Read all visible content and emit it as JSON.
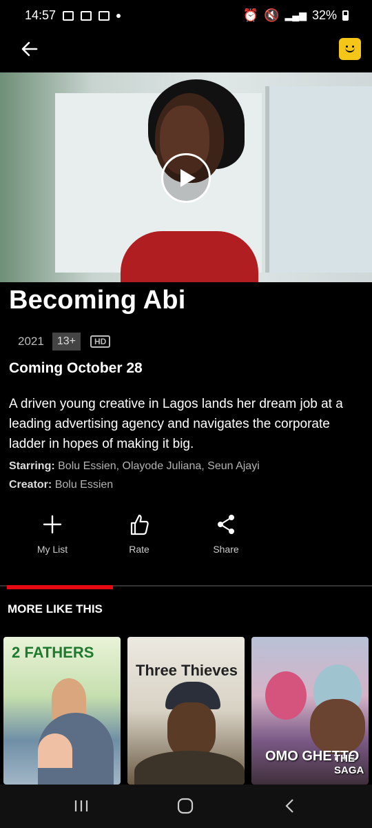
{
  "status_bar": {
    "time": "14:57",
    "battery": "32%"
  },
  "show": {
    "title": "Becoming Abi",
    "year": "2021",
    "rating": "13+",
    "quality": "HD",
    "availability": "Coming October 28",
    "description": "A driven young creative in Lagos lands her dream job at a leading advertising agency and navigates the corporate ladder in hopes of making it big.",
    "starring_label": "Starring:",
    "starring": "Bolu Essien, Olayode Juliana, Seun Ajayi",
    "creator_label": "Creator:",
    "creator": "Bolu Essien"
  },
  "actions": [
    {
      "label": "My List",
      "icon": "plus-icon"
    },
    {
      "label": "Rate",
      "icon": "thumbs-up-icon"
    },
    {
      "label": "Share",
      "icon": "share-icon"
    }
  ],
  "more_like_this": {
    "title": "MORE LIKE THIS",
    "posters": [
      {
        "title": "2 FATHERS"
      },
      {
        "title": "Three Thieves"
      },
      {
        "title": "OMO GHETTO",
        "subtitle": "THE SAGA"
      }
    ]
  },
  "colors": {
    "accent": "#e50914",
    "profile": "#f5c518",
    "background": "#000000"
  }
}
